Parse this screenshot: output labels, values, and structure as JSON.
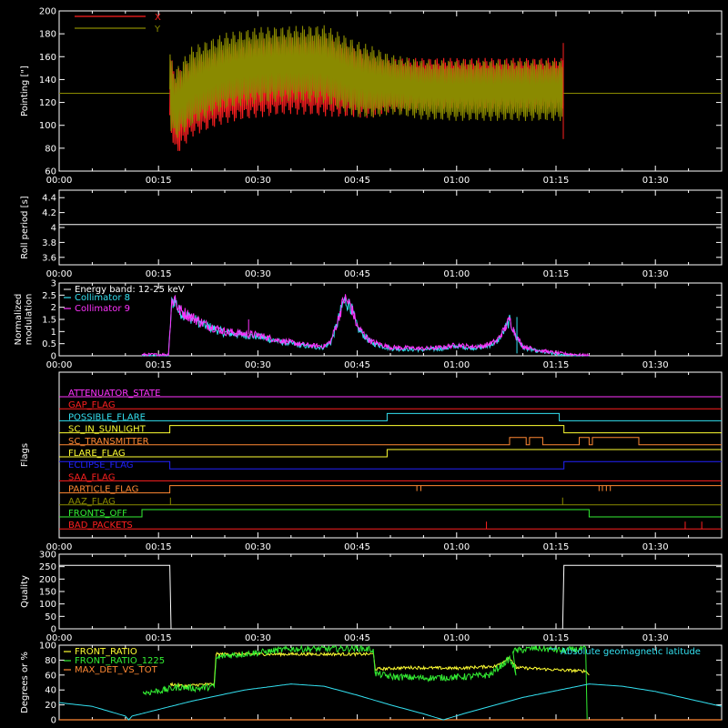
{
  "colors": {
    "background": "#000000",
    "axes": "#ffffff",
    "red": "#ff2020",
    "olive": "#8a8a00",
    "white": "#ffffff",
    "cyan": "#33e0f0",
    "magenta": "#ff33ff",
    "yellow": "#ffff33",
    "green": "#33ee33"
  },
  "chart_data": [
    {
      "id": "pointing",
      "type": "line",
      "ylabel": "Pointing [\"]",
      "ylim": [
        60,
        200
      ],
      "yticks": [
        60,
        80,
        100,
        120,
        140,
        160,
        180,
        200
      ],
      "xticklabels": [
        "00:00",
        "00:15",
        "00:30",
        "00:45",
        "01:00",
        "01:15",
        "01:30"
      ],
      "x_unit": "minutes",
      "xlim": [
        0,
        100
      ],
      "series": [
        {
          "name": "X",
          "color": "#ff2020"
        },
        {
          "name": "Y",
          "color": "#8a8a00"
        }
      ],
      "data_window": [
        16.7,
        76.1
      ],
      "baseline_outside_window": 128,
      "envelope": {
        "x": [
          16.7,
          17.5,
          20,
          25,
          30,
          35,
          40,
          45,
          47.5,
          50,
          55,
          60,
          65,
          70,
          76.1
        ],
        "X_upper": [
          165,
          150,
          160,
          170,
          178,
          180,
          180,
          170,
          162,
          160,
          160,
          160,
          160,
          160,
          160
        ],
        "X_lower": [
          100,
          70,
          88,
          100,
          105,
          108,
          106,
          105,
          105,
          110,
          113,
          113,
          113,
          113,
          113
        ],
        "Y_upper": [
          165,
          150,
          170,
          182,
          187,
          188,
          189,
          175,
          170,
          163,
          158,
          158,
          158,
          158,
          158
        ],
        "Y_lower": [
          95,
          85,
          97,
          112,
          117,
          119,
          117,
          105,
          104,
          108,
          103,
          102,
          102,
          102,
          102
        ]
      }
    },
    {
      "id": "roll",
      "type": "line",
      "ylabel": "Roll period [s]",
      "ylim": [
        3.5,
        4.5
      ],
      "yticks": [
        3.6,
        3.8,
        4.0,
        4.2,
        4.4
      ],
      "xticklabels": [
        "00:00",
        "00:15",
        "00:30",
        "00:45",
        "01:00",
        "01:15",
        "01:30"
      ],
      "series": [
        {
          "name": "roll period",
          "color": "#ffffff",
          "value": 4.04
        }
      ]
    },
    {
      "id": "modulation",
      "type": "line",
      "ylabel": "Normalized modulation",
      "ylabel_lines": [
        "Normalized",
        "modulation"
      ],
      "ylim": [
        0,
        3
      ],
      "yticks": [
        0.0,
        0.5,
        1.0,
        1.5,
        2.0,
        2.5,
        3.0
      ],
      "xticklabels": [
        "00:00",
        "00:15",
        "00:30",
        "00:45",
        "01:00",
        "01:15",
        "01:30"
      ],
      "legend_title": "Energy band: 12-25 keV",
      "series": [
        {
          "name": "Collimator 8",
          "color": "#33e0f0"
        },
        {
          "name": "Collimator 9",
          "color": "#ff33ff"
        }
      ],
      "profile": {
        "x": [
          12.5,
          16.5,
          17,
          17.5,
          18,
          20,
          22,
          25,
          28,
          30,
          33,
          36,
          38,
          40,
          41,
          42,
          43,
          44,
          45,
          47,
          50,
          55,
          58,
          60,
          62,
          64,
          66,
          67,
          68,
          69,
          70,
          72,
          75,
          78,
          80
        ],
        "y": [
          0.05,
          0.05,
          2.2,
          2.4,
          1.9,
          1.6,
          1.3,
          1.0,
          0.9,
          0.85,
          0.65,
          0.5,
          0.42,
          0.4,
          0.6,
          1.4,
          2.35,
          2.1,
          1.2,
          0.6,
          0.35,
          0.3,
          0.35,
          0.45,
          0.38,
          0.4,
          0.6,
          1.0,
          1.5,
          0.8,
          0.4,
          0.25,
          0.12,
          0.05,
          0.02
        ]
      }
    },
    {
      "id": "flags",
      "type": "line",
      "ylabel": "Flags",
      "xticklabels": [
        "00:00",
        "00:15",
        "00:30",
        "00:45",
        "01:00",
        "01:15",
        "01:30"
      ],
      "series": [
        {
          "name": "ATTENUATOR_STATE",
          "color": "#ff33ff",
          "steps": [
            [
              0,
              0
            ],
            [
              100,
              0
            ]
          ]
        },
        {
          "name": "GAP_FLAG",
          "color": "#ff2020",
          "steps": [
            [
              0,
              0
            ],
            [
              100,
              0
            ]
          ]
        },
        {
          "name": "POSSIBLE_FLARE",
          "color": "#33e0f0",
          "steps": [
            [
              0,
              0
            ],
            [
              49.5,
              0
            ],
            [
              49.5,
              1
            ],
            [
              75.5,
              1
            ],
            [
              75.5,
              0
            ],
            [
              100,
              0
            ]
          ]
        },
        {
          "name": "SC_IN_SUNLIGHT",
          "color": "#ffff33",
          "steps": [
            [
              0,
              0
            ],
            [
              16.7,
              0
            ],
            [
              16.7,
              1
            ],
            [
              76.2,
              1
            ],
            [
              76.2,
              0
            ],
            [
              100,
              0
            ]
          ]
        },
        {
          "name": "SC_TRANSMITTER",
          "color": "#ff8833",
          "steps": [
            [
              0,
              0
            ],
            [
              68,
              0
            ],
            [
              68,
              1
            ],
            [
              70.5,
              1
            ],
            [
              70.5,
              0
            ],
            [
              71,
              0
            ],
            [
              71,
              1
            ],
            [
              73,
              1
            ],
            [
              73,
              0
            ],
            [
              78.5,
              0
            ],
            [
              78.5,
              1
            ],
            [
              80,
              1
            ],
            [
              80,
              0
            ],
            [
              80.5,
              0
            ],
            [
              80.5,
              1
            ],
            [
              87.5,
              1
            ],
            [
              87.5,
              0
            ],
            [
              100,
              0
            ]
          ]
        },
        {
          "name": "FLARE_FLAG",
          "color": "#ffff33",
          "steps": [
            [
              0,
              0
            ],
            [
              49.5,
              0
            ],
            [
              49.5,
              1
            ],
            [
              100,
              1
            ]
          ]
        },
        {
          "name": "ECLIPSE_FLAG",
          "color": "#2222ff",
          "steps": [
            [
              0,
              1
            ],
            [
              16.7,
              1
            ],
            [
              16.7,
              0
            ],
            [
              76.2,
              0
            ],
            [
              76.2,
              1
            ],
            [
              100,
              1
            ]
          ]
        },
        {
          "name": "SAA_FLAG",
          "color": "#ff2020",
          "steps": [
            [
              0,
              0
            ],
            [
              100,
              0
            ]
          ]
        },
        {
          "name": "PARTICLE_FLAG",
          "color": "#ff8833",
          "steps": [
            [
              0,
              0
            ],
            [
              16.7,
              0
            ],
            [
              16.7,
              1
            ],
            [
              100,
              1
            ]
          ],
          "spikes": [
            54.0,
            54.6,
            81.5,
            82.0,
            82.6,
            83.2
          ]
        },
        {
          "name": "AAZ_FLAG",
          "color": "#8a8a00",
          "steps": [
            [
              0,
              0
            ],
            [
              100,
              0
            ]
          ],
          "spikes": [
            16.8,
            76.0
          ]
        },
        {
          "name": "FRONTS_OFF",
          "color": "#33ee33",
          "steps": [
            [
              0,
              0
            ],
            [
              12.5,
              0
            ],
            [
              12.5,
              1
            ],
            [
              80.0,
              1
            ],
            [
              80.0,
              0
            ],
            [
              100,
              0
            ]
          ]
        },
        {
          "name": "BAD_PACKETS",
          "color": "#ff2020",
          "steps": [
            [
              0,
              0
            ],
            [
              100,
              0
            ]
          ],
          "spikes": [
            64.5,
            94.5,
            97.0
          ]
        }
      ]
    },
    {
      "id": "quality",
      "type": "line",
      "ylabel": "Quality",
      "ylim": [
        0,
        300
      ],
      "yticks": [
        0,
        50,
        100,
        150,
        200,
        250,
        300
      ],
      "xticklabels": [
        "00:00",
        "00:15",
        "00:30",
        "00:45",
        "01:00",
        "01:15",
        "01:30"
      ],
      "series": [
        {
          "name": "quality",
          "color": "#ffffff",
          "steps": [
            [
              0,
              255
            ],
            [
              16.7,
              255
            ],
            [
              16.9,
              0
            ],
            [
              76.0,
              0
            ],
            [
              76.2,
              255
            ],
            [
              100,
              255
            ]
          ]
        }
      ]
    },
    {
      "id": "ratios",
      "type": "line",
      "ylabel": "Degrees or %",
      "ylim": [
        0,
        100
      ],
      "yticks": [
        0,
        20,
        40,
        60,
        80,
        100
      ],
      "series": [
        {
          "name": "FRONT_RATIO",
          "color": "#ffff33",
          "points": [
            [
              16.8,
              48
            ],
            [
              19,
              45
            ],
            [
              21,
              47
            ],
            [
              23.5,
              48
            ],
            [
              23.7,
              88
            ],
            [
              30,
              88
            ],
            [
              40,
              88
            ],
            [
              47.5,
              88
            ],
            [
              47.7,
              68
            ],
            [
              53,
              70
            ],
            [
              60,
              69
            ],
            [
              66,
              72
            ],
            [
              68,
              84
            ],
            [
              69,
              70
            ],
            [
              75,
              67
            ],
            [
              79.8,
              65
            ],
            [
              80,
              60
            ]
          ]
        },
        {
          "name": "FRONT_RATIO_1225",
          "color": "#33ee33",
          "points": [
            [
              12.6,
              0
            ],
            [
              12.7,
              36
            ],
            [
              16,
              40
            ],
            [
              18,
              44
            ],
            [
              21,
              42
            ],
            [
              23.5,
              45
            ],
            [
              23.7,
              82
            ],
            [
              25,
              86
            ],
            [
              30,
              90
            ],
            [
              35,
              95
            ],
            [
              40,
              95
            ],
            [
              45,
              96
            ],
            [
              47.5,
              94
            ],
            [
              47.7,
              62
            ],
            [
              50,
              58
            ],
            [
              55,
              56
            ],
            [
              60,
              57
            ],
            [
              65,
              60
            ],
            [
              68,
              82
            ],
            [
              69,
              62
            ],
            [
              68.5,
              92
            ],
            [
              72,
              96
            ],
            [
              76,
              93
            ],
            [
              79.5,
              95
            ],
            [
              79.7,
              0
            ]
          ]
        },
        {
          "name": "MAX_DET_VS_TOT",
          "color": "#ff8833",
          "constant": 0
        },
        {
          "name": "Absolute geomagnetic latitude",
          "color": "#33e0f0",
          "points": [
            [
              0,
              23
            ],
            [
              5,
              18
            ],
            [
              10,
              5
            ],
            [
              10.5,
              0
            ],
            [
              11,
              5
            ],
            [
              20,
              25
            ],
            [
              28,
              40
            ],
            [
              35,
              48
            ],
            [
              40,
              45
            ],
            [
              45,
              33
            ],
            [
              50,
              20
            ],
            [
              55,
              8
            ],
            [
              58,
              0
            ],
            [
              61,
              8
            ],
            [
              70,
              30
            ],
            [
              80,
              48
            ],
            [
              85,
              45
            ],
            [
              90,
              38
            ],
            [
              95,
              28
            ],
            [
              100,
              18
            ]
          ]
        }
      ]
    }
  ]
}
